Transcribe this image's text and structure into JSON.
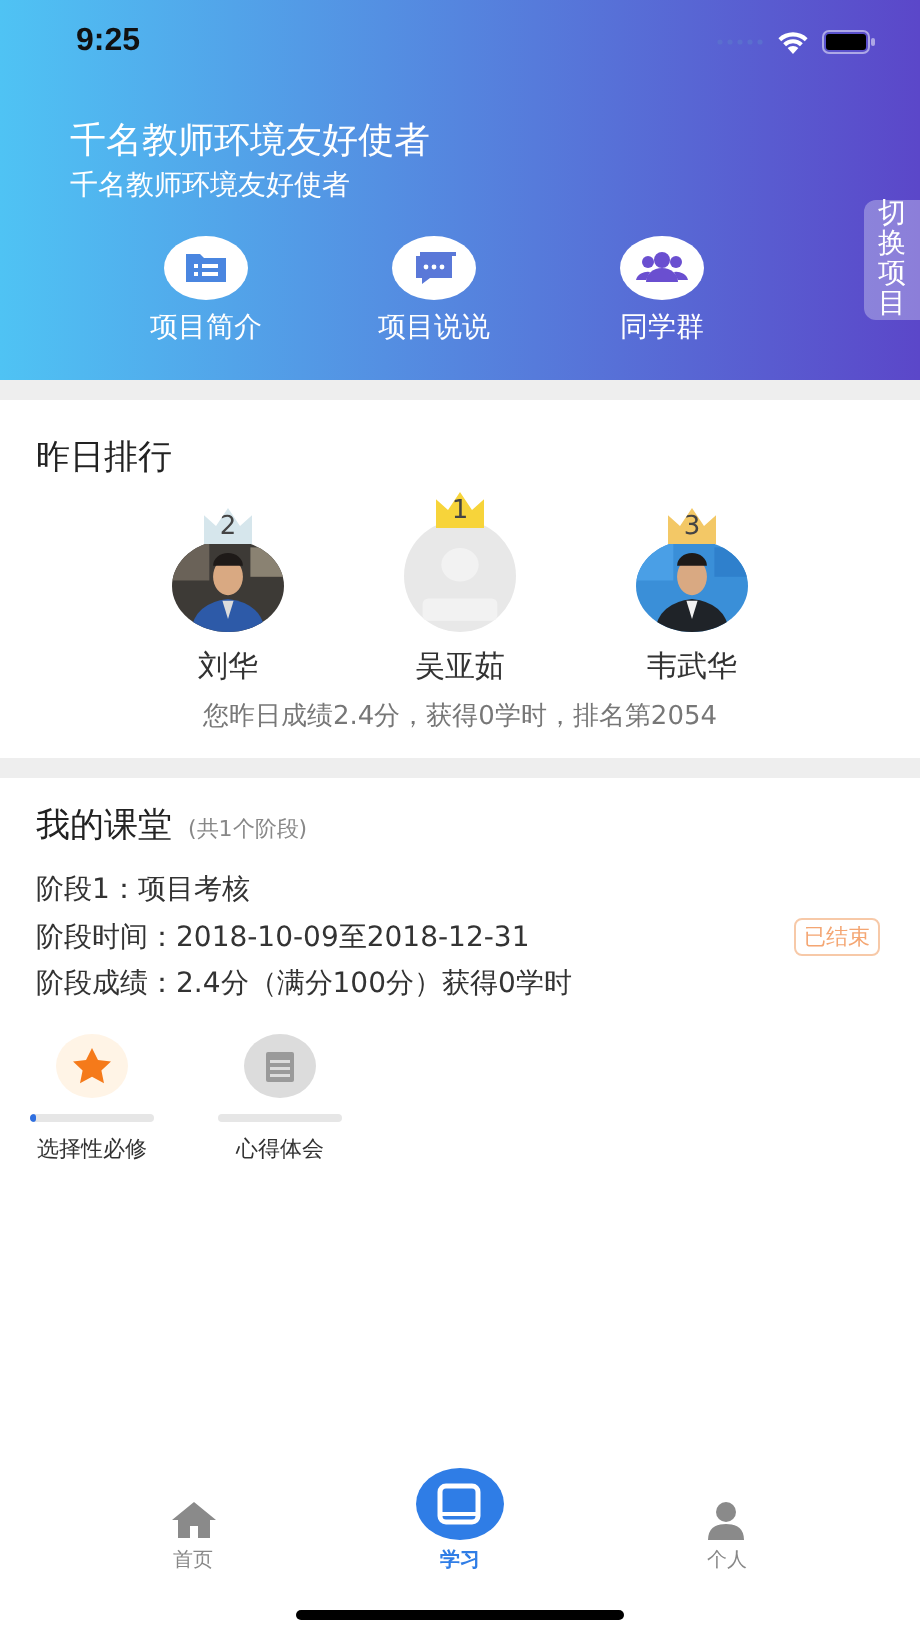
{
  "status_bar": {
    "time": "9:25"
  },
  "header": {
    "title": "千名教师环境友好使者",
    "subtitle": "千名教师环境友好使者",
    "switch_label": "切换项目",
    "shortcuts": [
      {
        "kind": "intro",
        "label": "项目简介"
      },
      {
        "kind": "talk",
        "label": "项目说说"
      },
      {
        "kind": "group",
        "label": "同学群"
      }
    ]
  },
  "ranking": {
    "title": "昨日排行",
    "podium": [
      {
        "rank": "2",
        "name": "刘华",
        "color": "#d6e6ec",
        "kind": "picture"
      },
      {
        "rank": "1",
        "name": "吴亚茹",
        "color": "#f7d43a",
        "kind": "placeholder"
      },
      {
        "rank": "3",
        "name": "韦武华",
        "color": "#f3c866",
        "kind": "picture"
      }
    ],
    "summary": "您昨日成绩2.4分，获得0学时，排名第2054"
  },
  "classroom": {
    "title": "我的课堂",
    "count": "(共1个阶段)",
    "lines": [
      "阶段1：项目考核",
      "阶段时间：2018-10-09至2018-12-31",
      "阶段成绩：2.4分（满分100分）获得0学时"
    ],
    "status": "已结束",
    "modules": [
      {
        "kind": "star",
        "label": "选择性必修",
        "level": 0.05
      },
      {
        "kind": "notes",
        "label": "心得体会"
      }
    ]
  },
  "tab_bar": [
    {
      "kind": "home",
      "label": "首页",
      "selected": false
    },
    {
      "kind": "study",
      "label": "学习",
      "selected": true
    },
    {
      "kind": "person",
      "label": "个人",
      "selected": false
    }
  ]
}
